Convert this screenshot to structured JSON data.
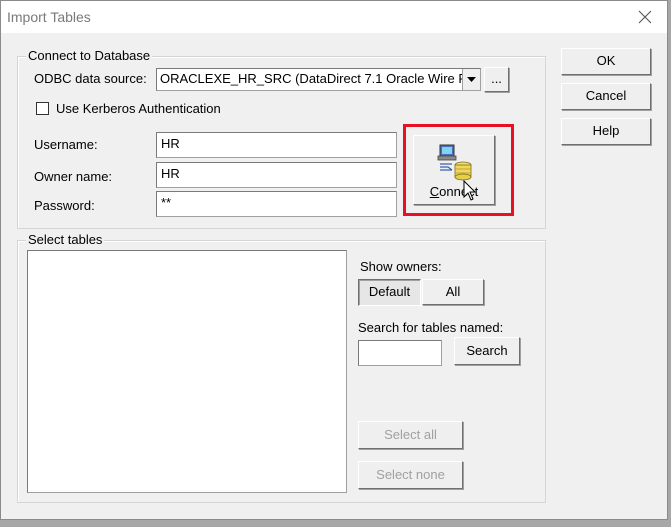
{
  "window": {
    "title": "Import Tables"
  },
  "connect_group": {
    "legend": "Connect to Database",
    "odbc_label": "ODBC data source:",
    "odbc_value": "ORACLEXE_HR_SRC (DataDirect 7.1 Oracle Wire P",
    "browse_label": "...",
    "kerberos_label": "Use Kerberos Authentication",
    "kerberos_checked": false,
    "username_label": "Username:",
    "username_value": "HR",
    "owner_label": "Owner name:",
    "owner_value": "HR",
    "password_label": "Password:",
    "password_value": "**",
    "connect_label": "Connect",
    "connect_icon": "database-connect-icon",
    "highlight_color": "#e81123"
  },
  "select_group": {
    "legend": "Select tables",
    "tables": [],
    "show_owners_label": "Show owners:",
    "default_label": "Default",
    "all_label": "All",
    "search_label": "Search for tables named:",
    "search_value": "",
    "search_button": "Search",
    "select_all": "Select all",
    "select_none": "Select none"
  },
  "buttons": {
    "ok": "OK",
    "cancel": "Cancel",
    "help": "Help"
  }
}
